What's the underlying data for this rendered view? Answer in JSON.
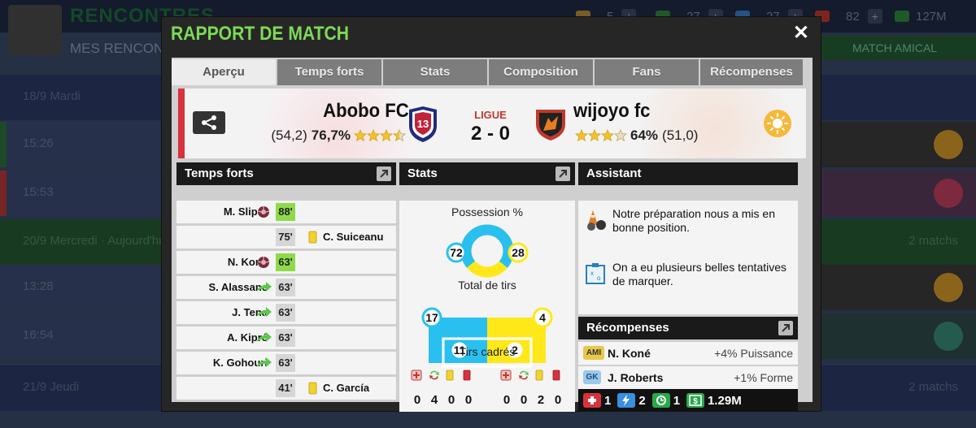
{
  "background": {
    "title": "RENCONTRES",
    "subtitle": "MES RENCONTRES",
    "resources": [
      "5",
      "27",
      "27",
      "82",
      "127M"
    ],
    "button": "MATCH AMICAL",
    "rows": [
      {
        "text": "18/9 Mardi"
      },
      {
        "text": "15:26"
      },
      {
        "text": "15:53"
      },
      {
        "text": "20/9 Mercredi · Aujourd'hui",
        "right": "2 matchs"
      },
      {
        "text": "13:28"
      },
      {
        "text": "16:54"
      },
      {
        "text": "21/9 Jeudi",
        "right": "2 matchs"
      }
    ]
  },
  "dialog": {
    "title": "RAPPORT DE MATCH",
    "tabs": [
      "Aperçu",
      "Temps forts",
      "Stats",
      "Composition",
      "Fans",
      "Récompenses"
    ],
    "active_tab": 0
  },
  "match": {
    "home_team": "Abobo FC",
    "home_rating_prefix": "(54,2)",
    "home_pct": "76,7%",
    "home_stars": 3.5,
    "away_team": "wijoyo fc",
    "away_pct": "64%",
    "away_rating_suffix": "(51,0)",
    "away_stars": 3,
    "competition": "LIGUE",
    "score": "2 - 0"
  },
  "highlights": {
    "title": "Temps forts",
    "items": [
      {
        "name": "M. Sliper",
        "minute": "88'",
        "side": "home",
        "type": "goal"
      },
      {
        "name": "C. Suiceanu",
        "minute": "75'",
        "side": "away",
        "type": "yellow"
      },
      {
        "name": "N. Koné",
        "minute": "63'",
        "side": "home",
        "type": "goal"
      },
      {
        "name": "S. Alassane",
        "minute": "63'",
        "side": "home",
        "type": "sub"
      },
      {
        "name": "J. Tena",
        "minute": "63'",
        "side": "home",
        "type": "sub"
      },
      {
        "name": "A. Kipré",
        "minute": "63'",
        "side": "home",
        "type": "sub"
      },
      {
        "name": "K. Gohouri",
        "minute": "63'",
        "side": "home",
        "type": "sub"
      },
      {
        "name": "C. García",
        "minute": "41'",
        "side": "away",
        "type": "yellow"
      }
    ]
  },
  "stats": {
    "title": "Stats",
    "possession_label": "Possession %",
    "possession_home": 72,
    "possession_away": 28,
    "shots_label": "Total de tirs",
    "shots_home": 17,
    "shots_away": 4,
    "on_target_label": "Tirs cadrés",
    "on_target_home": 11,
    "on_target_away": 2,
    "home_cards": [
      "0",
      "4",
      "0",
      "0"
    ],
    "away_cards": [
      "0",
      "0",
      "2",
      "0"
    ],
    "colors": {
      "home": "#29c0f0",
      "away": "#ffe81a"
    }
  },
  "assistant": {
    "title": "Assistant",
    "tips": [
      "Notre préparation nous a mis en bonne position.",
      "On a eu plusieurs belles tentatives de marquer."
    ]
  },
  "rewards": {
    "title": "Récompenses",
    "items": [
      {
        "badge": "AMI",
        "name": "N. Koné",
        "bonus": "+4% Puissance"
      },
      {
        "badge": "GK",
        "name": "J. Roberts",
        "bonus": "+1% Forme"
      }
    ],
    "money": [
      {
        "icon": "health-pack-icon",
        "value": "1"
      },
      {
        "icon": "energy-icon",
        "value": "2"
      },
      {
        "icon": "time-icon",
        "value": "1"
      },
      {
        "icon": "cash-icon",
        "value": "1.29M"
      }
    ]
  }
}
